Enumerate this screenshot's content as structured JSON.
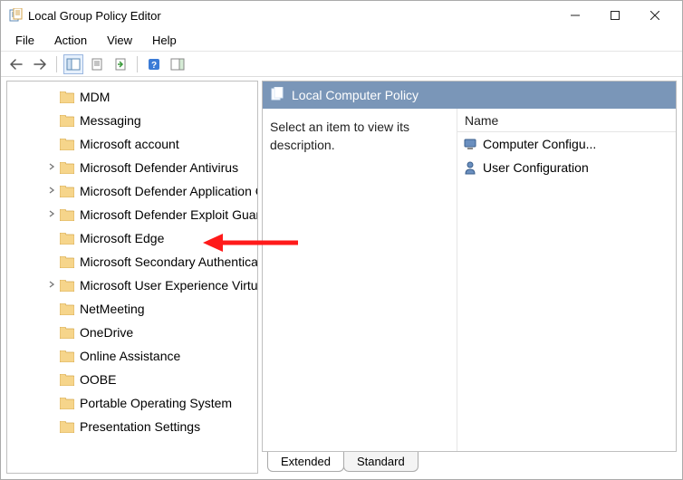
{
  "window": {
    "title": "Local Group Policy Editor"
  },
  "menubar": [
    "File",
    "Action",
    "View",
    "Help"
  ],
  "toolbar": {
    "back": "back-arrow",
    "forward": "forward-arrow",
    "sep1": true,
    "tree_toggle": "tree-pane-toggle",
    "props": "properties",
    "export": "export-list",
    "sep2": true,
    "help": "help",
    "run": "show-hide-action-pane"
  },
  "tree_items": [
    {
      "label": "MDM",
      "expandable": false
    },
    {
      "label": "Messaging",
      "expandable": false
    },
    {
      "label": "Microsoft account",
      "expandable": false
    },
    {
      "label": "Microsoft Defender Antivirus",
      "expandable": true
    },
    {
      "label": "Microsoft Defender Application Guard",
      "expandable": true
    },
    {
      "label": "Microsoft Defender Exploit Guard",
      "expandable": true
    },
    {
      "label": "Microsoft Edge",
      "expandable": false,
      "highlighted": true
    },
    {
      "label": "Microsoft Secondary Authentication Factor",
      "expandable": false
    },
    {
      "label": "Microsoft User Experience Virtualization",
      "expandable": true
    },
    {
      "label": "NetMeeting",
      "expandable": false
    },
    {
      "label": "OneDrive",
      "expandable": false
    },
    {
      "label": "Online Assistance",
      "expandable": false
    },
    {
      "label": "OOBE",
      "expandable": false
    },
    {
      "label": "Portable Operating System",
      "expandable": false
    },
    {
      "label": "Presentation Settings",
      "expandable": false
    }
  ],
  "details": {
    "header_title": "Local Computer Policy",
    "description": "Select an item to view its description.",
    "column_header": "Name",
    "items": [
      {
        "icon": "computer",
        "label": "Computer Configu..."
      },
      {
        "icon": "user",
        "label": "User Configuration"
      }
    ]
  },
  "tabs": {
    "extended": "Extended",
    "standard": "Standard",
    "active": "extended"
  }
}
